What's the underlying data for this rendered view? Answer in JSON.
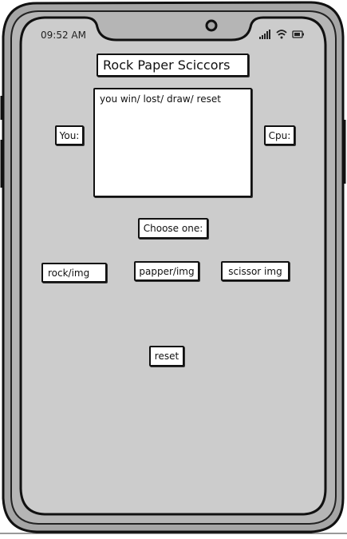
{
  "status_bar": {
    "time": "09:52 AM",
    "icons": [
      "signal-icon",
      "wifi-icon",
      "battery-icon"
    ]
  },
  "app": {
    "title": "Rock Paper Sciccors",
    "result_text": "you win/ lost/ draw/ reset",
    "you_label": "You:",
    "cpu_label": "Cpu:",
    "choose_label": "Choose one:",
    "choices": {
      "rock": "rock/img",
      "paper": "papper/img",
      "scissor": "scissor img"
    },
    "reset_label": "reset"
  },
  "colors": {
    "phone_frame": "#a6a6a6",
    "screen": "#cccccc",
    "outline": "#111111",
    "box_fill": "#ffffff"
  }
}
